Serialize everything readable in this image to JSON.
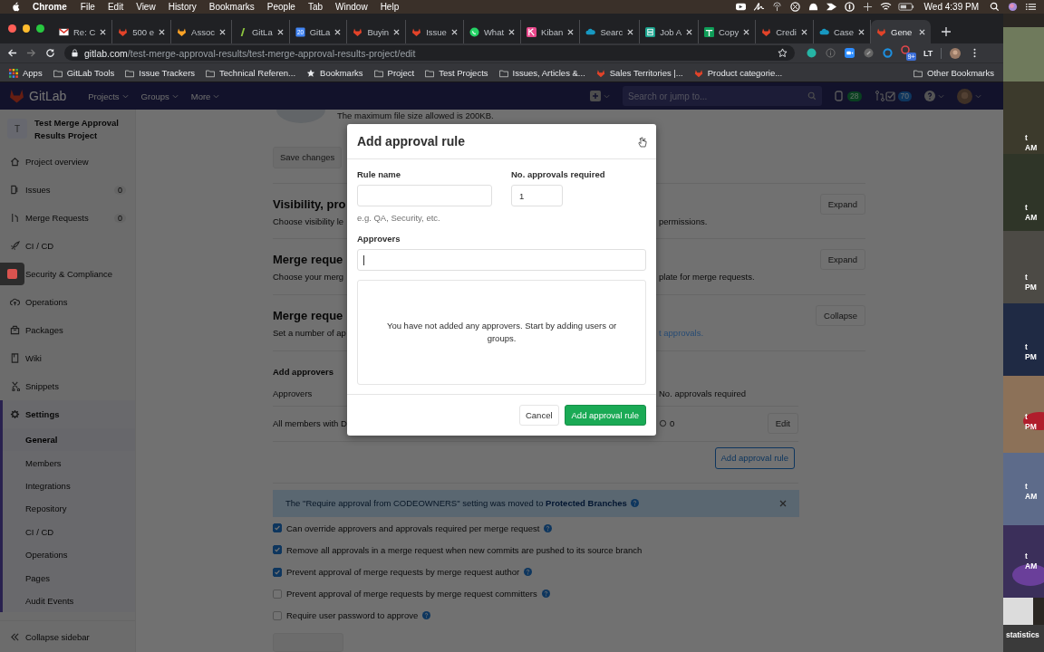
{
  "menubar": {
    "app": "Chrome",
    "menus": [
      "File",
      "Edit",
      "View",
      "History",
      "Bookmarks",
      "People",
      "Tab",
      "Window",
      "Help"
    ],
    "clock": "Wed 4:39 PM"
  },
  "browser": {
    "tabs": [
      {
        "title": "Re: C",
        "kind": "mail",
        "selected": false
      },
      {
        "title": "500 e",
        "kind": "fox",
        "selected": false
      },
      {
        "title": "Assoc",
        "kind": "fox-yellow",
        "selected": false
      },
      {
        "title": "GitLa",
        "kind": "leaf",
        "selected": false
      },
      {
        "title": "GitLa",
        "kind": "calendar",
        "icon_text": "20",
        "selected": false
      },
      {
        "title": "Buyin",
        "kind": "fox",
        "selected": false
      },
      {
        "title": "Issue",
        "kind": "fox",
        "selected": false
      },
      {
        "title": "What",
        "kind": "chat",
        "selected": false
      },
      {
        "title": "Kiban",
        "kind": "kibana",
        "selected": false
      },
      {
        "title": "Searc",
        "kind": "cloud",
        "selected": false
      },
      {
        "title": "Job A",
        "kind": "grid",
        "selected": false
      },
      {
        "title": "Copy",
        "kind": "sheet",
        "selected": false
      },
      {
        "title": "Credi",
        "kind": "fox",
        "selected": false
      },
      {
        "title": "Case",
        "kind": "cloud",
        "selected": false
      },
      {
        "title": "Gene",
        "kind": "fox",
        "selected": true
      }
    ],
    "url_host": "gitlab.com",
    "url_path": "/test-merge-approval-results/test-merge-approval-results-project/edit",
    "extensions": [
      {
        "kind": "teal"
      },
      {
        "kind": "info"
      },
      {
        "kind": "video"
      },
      {
        "kind": "link"
      },
      {
        "kind": "ring"
      },
      {
        "kind": "pin",
        "badge": "9+"
      },
      {
        "kind": "text",
        "text": "LT"
      }
    ],
    "bookmarks": [
      {
        "label": "Apps",
        "kind": "apps"
      },
      {
        "label": "GitLab Tools",
        "kind": "folder"
      },
      {
        "label": "Issue Trackers",
        "kind": "folder"
      },
      {
        "label": "Technical Referen...",
        "kind": "folder"
      },
      {
        "label": "Bookmarks",
        "kind": "star"
      },
      {
        "label": "Project",
        "kind": "folder"
      },
      {
        "label": "Test Projects",
        "kind": "folder"
      },
      {
        "label": "Issues, Articles &...",
        "kind": "folder"
      },
      {
        "label": "Sales Territories |...",
        "kind": "fox"
      },
      {
        "label": "Product categorie...",
        "kind": "fox"
      }
    ],
    "other_bookmarks": "Other Bookmarks"
  },
  "gitlab_nav": {
    "brand": "GitLab",
    "menus": [
      "Projects",
      "Groups",
      "More"
    ],
    "search": {
      "placeholder": "Search or jump to..."
    },
    "issues_count": "28",
    "todos_count": "70"
  },
  "sidebar": {
    "avatar_letter": "T",
    "project": "Test Merge Approval Results Project",
    "items": [
      {
        "label": "Project overview",
        "kind": "home",
        "selected": false
      },
      {
        "label": "Issues",
        "kind": "issues",
        "count": "0",
        "selected": false
      },
      {
        "label": "Merge Requests",
        "kind": "merge",
        "count": "0",
        "selected": false
      },
      {
        "label": "CI / CD",
        "kind": "rocket",
        "selected": false
      },
      {
        "label": "Security & Compliance",
        "selected": false
      },
      {
        "label": "Operations",
        "kind": "cloud",
        "selected": false
      },
      {
        "label": "Packages",
        "kind": "package",
        "selected": false
      },
      {
        "label": "Wiki",
        "kind": "book",
        "selected": false
      },
      {
        "label": "Snippets",
        "kind": "scissors",
        "selected": false
      },
      {
        "label": "Settings",
        "kind": "gear",
        "selected": true,
        "children": [
          {
            "label": "General",
            "selected": true
          },
          {
            "label": "Members",
            "selected": false
          },
          {
            "label": "Integrations",
            "selected": false
          },
          {
            "label": "Repository",
            "selected": false
          },
          {
            "label": "CI / CD",
            "selected": false
          },
          {
            "label": "Operations",
            "selected": false
          },
          {
            "label": "Pages",
            "selected": false
          },
          {
            "label": "Audit Events",
            "selected": false
          }
        ]
      }
    ],
    "collapse": "Collapse sidebar"
  },
  "main": {
    "avatar_note": "The maximum file size allowed is 200KB.",
    "save_top": "Save changes",
    "sections": [
      {
        "title": "Visibility, pro",
        "desc": "Choose visibility le",
        "desc_right": {
          "text": "permissions.",
          "link": false
        },
        "button": "Expand"
      },
      {
        "title": "Merge reque",
        "desc": "Choose your merg",
        "desc_right": {
          "text": "plate for merge requests.",
          "link": false
        },
        "button": "Expand"
      },
      {
        "title": "Merge reque",
        "desc": "Set a number of ap",
        "desc_right": {
          "text": "t approvals.",
          "link": true
        },
        "button": "Collapse"
      }
    ],
    "approvers": {
      "heading": "Add approvers",
      "columns": [
        "Approvers",
        "No. approvals required"
      ],
      "row": {
        "name": "All members with D",
        "count": "0",
        "button": "Edit"
      },
      "add_button": "Add approval rule"
    },
    "banner": {
      "text": "The \"Require approval from CODEOWNERS\" setting was moved to",
      "link": "Protected Branches"
    },
    "options": [
      {
        "label": "Can override approvers and approvals required per merge request",
        "checked": true,
        "help": true
      },
      {
        "label": "Remove all approvals in a merge request when new commits are pushed to its source branch",
        "checked": true,
        "help": false
      },
      {
        "label": "Prevent approval of merge requests by merge request author",
        "checked": true,
        "help": true
      },
      {
        "label": "Prevent approval of merge requests by merge request committers",
        "checked": false,
        "help": true
      },
      {
        "label": "Require user password to approve",
        "checked": false,
        "help": true
      }
    ]
  },
  "modal": {
    "title": "Add approval rule",
    "rule_name": {
      "label": "Rule name",
      "hint": "e.g. QA, Security, etc."
    },
    "approvals": {
      "label": "No. approvals required",
      "value": "1"
    },
    "approvers": {
      "label": "Approvers"
    },
    "empty_message": "You have not added any approvers. Start by adding users or groups.",
    "cancel": "Cancel",
    "submit": "Add approval rule"
  },
  "desktop": {
    "labels": [
      {
        "top": "t",
        "bottom": "AM"
      },
      {
        "top": "t",
        "bottom": "AM"
      },
      {
        "top": "t",
        "bottom": "PM"
      },
      {
        "top": "t",
        "bottom": "PM"
      },
      {
        "top": "t",
        "bottom": "PM"
      },
      {
        "top": "t",
        "bottom": "AM"
      },
      {
        "top": "t",
        "bottom": "AM"
      }
    ],
    "caption": "statistics"
  }
}
